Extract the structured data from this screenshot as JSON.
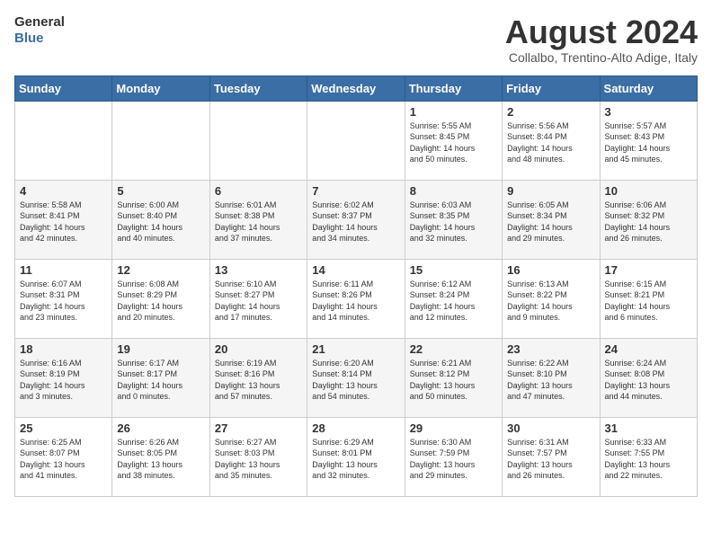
{
  "logo": {
    "line1": "General",
    "line2": "Blue"
  },
  "title": "August 2024",
  "subtitle": "Collalbo, Trentino-Alto Adige, Italy",
  "weekdays": [
    "Sunday",
    "Monday",
    "Tuesday",
    "Wednesday",
    "Thursday",
    "Friday",
    "Saturday"
  ],
  "rows": [
    [
      {
        "day": "",
        "detail": ""
      },
      {
        "day": "",
        "detail": ""
      },
      {
        "day": "",
        "detail": ""
      },
      {
        "day": "",
        "detail": ""
      },
      {
        "day": "1",
        "detail": "Sunrise: 5:55 AM\nSunset: 8:45 PM\nDaylight: 14 hours\nand 50 minutes."
      },
      {
        "day": "2",
        "detail": "Sunrise: 5:56 AM\nSunset: 8:44 PM\nDaylight: 14 hours\nand 48 minutes."
      },
      {
        "day": "3",
        "detail": "Sunrise: 5:57 AM\nSunset: 8:43 PM\nDaylight: 14 hours\nand 45 minutes."
      }
    ],
    [
      {
        "day": "4",
        "detail": "Sunrise: 5:58 AM\nSunset: 8:41 PM\nDaylight: 14 hours\nand 42 minutes."
      },
      {
        "day": "5",
        "detail": "Sunrise: 6:00 AM\nSunset: 8:40 PM\nDaylight: 14 hours\nand 40 minutes."
      },
      {
        "day": "6",
        "detail": "Sunrise: 6:01 AM\nSunset: 8:38 PM\nDaylight: 14 hours\nand 37 minutes."
      },
      {
        "day": "7",
        "detail": "Sunrise: 6:02 AM\nSunset: 8:37 PM\nDaylight: 14 hours\nand 34 minutes."
      },
      {
        "day": "8",
        "detail": "Sunrise: 6:03 AM\nSunset: 8:35 PM\nDaylight: 14 hours\nand 32 minutes."
      },
      {
        "day": "9",
        "detail": "Sunrise: 6:05 AM\nSunset: 8:34 PM\nDaylight: 14 hours\nand 29 minutes."
      },
      {
        "day": "10",
        "detail": "Sunrise: 6:06 AM\nSunset: 8:32 PM\nDaylight: 14 hours\nand 26 minutes."
      }
    ],
    [
      {
        "day": "11",
        "detail": "Sunrise: 6:07 AM\nSunset: 8:31 PM\nDaylight: 14 hours\nand 23 minutes."
      },
      {
        "day": "12",
        "detail": "Sunrise: 6:08 AM\nSunset: 8:29 PM\nDaylight: 14 hours\nand 20 minutes."
      },
      {
        "day": "13",
        "detail": "Sunrise: 6:10 AM\nSunset: 8:27 PM\nDaylight: 14 hours\nand 17 minutes."
      },
      {
        "day": "14",
        "detail": "Sunrise: 6:11 AM\nSunset: 8:26 PM\nDaylight: 14 hours\nand 14 minutes."
      },
      {
        "day": "15",
        "detail": "Sunrise: 6:12 AM\nSunset: 8:24 PM\nDaylight: 14 hours\nand 12 minutes."
      },
      {
        "day": "16",
        "detail": "Sunrise: 6:13 AM\nSunset: 8:22 PM\nDaylight: 14 hours\nand 9 minutes."
      },
      {
        "day": "17",
        "detail": "Sunrise: 6:15 AM\nSunset: 8:21 PM\nDaylight: 14 hours\nand 6 minutes."
      }
    ],
    [
      {
        "day": "18",
        "detail": "Sunrise: 6:16 AM\nSunset: 8:19 PM\nDaylight: 14 hours\nand 3 minutes."
      },
      {
        "day": "19",
        "detail": "Sunrise: 6:17 AM\nSunset: 8:17 PM\nDaylight: 14 hours\nand 0 minutes."
      },
      {
        "day": "20",
        "detail": "Sunrise: 6:19 AM\nSunset: 8:16 PM\nDaylight: 13 hours\nand 57 minutes."
      },
      {
        "day": "21",
        "detail": "Sunrise: 6:20 AM\nSunset: 8:14 PM\nDaylight: 13 hours\nand 54 minutes."
      },
      {
        "day": "22",
        "detail": "Sunrise: 6:21 AM\nSunset: 8:12 PM\nDaylight: 13 hours\nand 50 minutes."
      },
      {
        "day": "23",
        "detail": "Sunrise: 6:22 AM\nSunset: 8:10 PM\nDaylight: 13 hours\nand 47 minutes."
      },
      {
        "day": "24",
        "detail": "Sunrise: 6:24 AM\nSunset: 8:08 PM\nDaylight: 13 hours\nand 44 minutes."
      }
    ],
    [
      {
        "day": "25",
        "detail": "Sunrise: 6:25 AM\nSunset: 8:07 PM\nDaylight: 13 hours\nand 41 minutes."
      },
      {
        "day": "26",
        "detail": "Sunrise: 6:26 AM\nSunset: 8:05 PM\nDaylight: 13 hours\nand 38 minutes."
      },
      {
        "day": "27",
        "detail": "Sunrise: 6:27 AM\nSunset: 8:03 PM\nDaylight: 13 hours\nand 35 minutes."
      },
      {
        "day": "28",
        "detail": "Sunrise: 6:29 AM\nSunset: 8:01 PM\nDaylight: 13 hours\nand 32 minutes."
      },
      {
        "day": "29",
        "detail": "Sunrise: 6:30 AM\nSunset: 7:59 PM\nDaylight: 13 hours\nand 29 minutes."
      },
      {
        "day": "30",
        "detail": "Sunrise: 6:31 AM\nSunset: 7:57 PM\nDaylight: 13 hours\nand 26 minutes."
      },
      {
        "day": "31",
        "detail": "Sunrise: 6:33 AM\nSunset: 7:55 PM\nDaylight: 13 hours\nand 22 minutes."
      }
    ]
  ]
}
